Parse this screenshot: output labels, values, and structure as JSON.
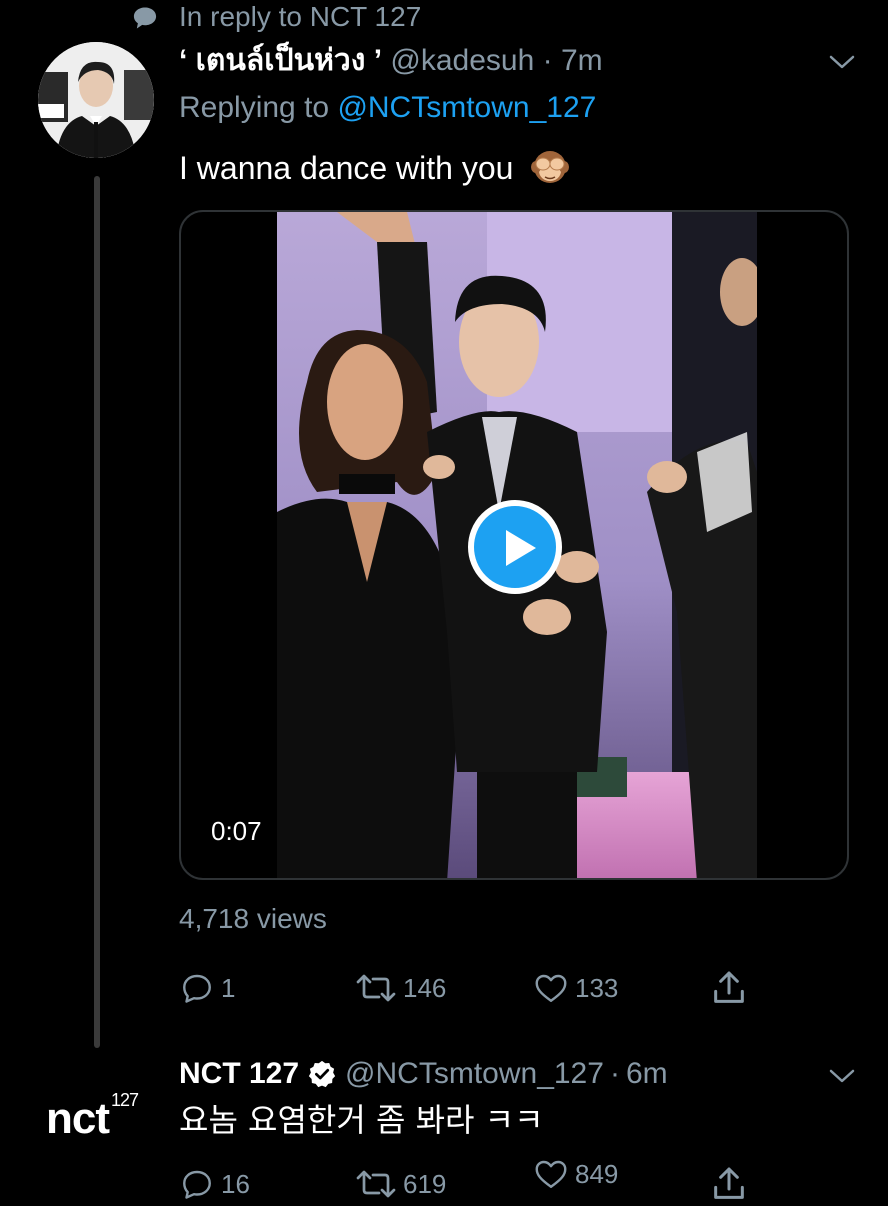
{
  "context": {
    "icon": "speech-bubble-icon",
    "text": "In reply to NCT 127"
  },
  "tweet1": {
    "display_name": "‘ เตนล์เป็นห่วง ’",
    "handle": "@kadesuh",
    "separator": "·",
    "time": "7m",
    "replying_prefix": "Replying to",
    "replying_to": "@NCTsmtown_127",
    "text": "I wanna dance with you",
    "emoji": "see-no-evil-monkey-icon",
    "video": {
      "duration": "0:07",
      "play_icon": "play-icon"
    },
    "views": "4,718 views",
    "actions": {
      "reply_count": "1",
      "retweet_count": "146",
      "like_count": "133"
    }
  },
  "tweet2": {
    "display_name": "NCT 127",
    "avatar_text": "nct",
    "avatar_sup": "127",
    "handle": "@NCTsmtown_127",
    "separator": "·",
    "time": "6m",
    "text": "요놈 요염한거 좀 봐라 ㅋㅋ",
    "actions": {
      "reply_count": "16",
      "retweet_count": "619",
      "like_count": "849"
    }
  },
  "colors": {
    "background": "#000000",
    "secondary_text": "#8899a6",
    "link": "#1da1f2",
    "play_button": "#1da1f2"
  }
}
